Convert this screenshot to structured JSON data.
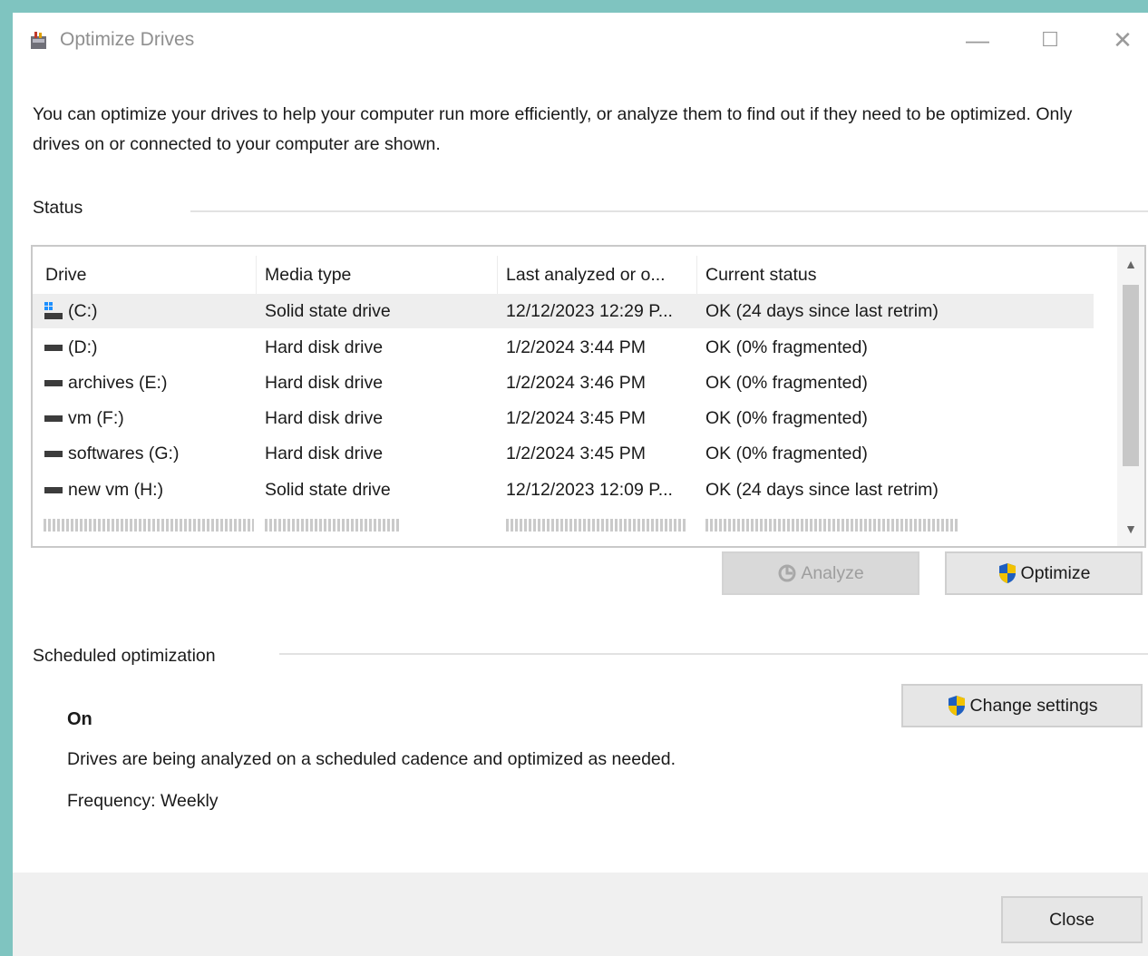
{
  "window": {
    "title": "Optimize Drives",
    "minimize_glyph": "—",
    "maximize_glyph": "☐",
    "close_glyph": "✕"
  },
  "intro_text": "You can optimize your drives to help your computer run more efficiently, or analyze them to find out if they need to be optimized. Only drives on or connected to your computer are shown.",
  "status": {
    "label": "Status",
    "columns": [
      "Drive",
      "Media type",
      "Last analyzed or o...",
      "Current status"
    ],
    "rows": [
      {
        "drive": "(C:)",
        "media": "Solid state drive",
        "last": "12/12/2023 12:29 P...",
        "status": "OK (24 days since last retrim)",
        "icon": "system-drive-icon",
        "selected": true
      },
      {
        "drive": "(D:)",
        "media": "Hard disk drive",
        "last": "1/2/2024 3:44 PM",
        "status": "OK (0% fragmented)",
        "icon": "drive-icon",
        "selected": false
      },
      {
        "drive": "archives (E:)",
        "media": "Hard disk drive",
        "last": "1/2/2024 3:46 PM",
        "status": "OK (0% fragmented)",
        "icon": "drive-icon",
        "selected": false
      },
      {
        "drive": "vm (F:)",
        "media": "Hard disk drive",
        "last": "1/2/2024 3:45 PM",
        "status": "OK (0% fragmented)",
        "icon": "drive-icon",
        "selected": false
      },
      {
        "drive": "softwares (G:)",
        "media": "Hard disk drive",
        "last": "1/2/2024 3:45 PM",
        "status": "OK (0% fragmented)",
        "icon": "drive-icon",
        "selected": false
      },
      {
        "drive": "new vm (H:)",
        "media": "Solid state drive",
        "last": "12/12/2023 12:09 P...",
        "status": "OK (24 days since last retrim)",
        "icon": "drive-icon",
        "selected": false
      }
    ],
    "analyze_label": "Analyze",
    "optimize_label": "Optimize"
  },
  "scheduled": {
    "label": "Scheduled optimization",
    "state": "On",
    "description": "Drives are being analyzed on a scheduled cadence and optimized as needed.",
    "frequency": "Frequency: Weekly",
    "change_label": "Change settings"
  },
  "footer": {
    "close_label": "Close"
  },
  "colors": {
    "accent_desktop": "#7fc4c0",
    "selected_row": "#eeeeee",
    "button_face": "#e6e6e6"
  }
}
